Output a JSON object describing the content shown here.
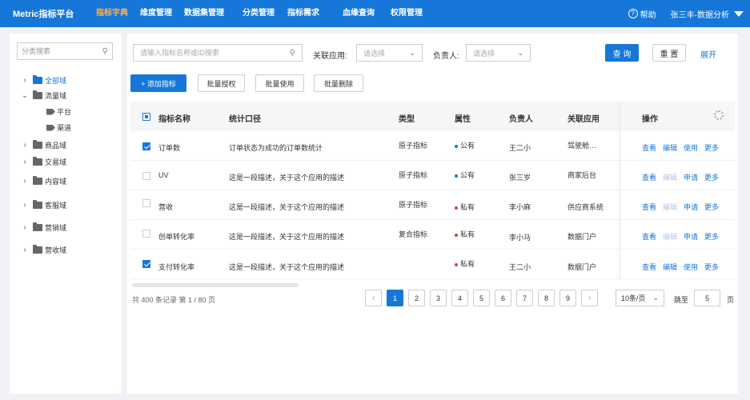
{
  "app": {
    "title": "Metric指标平台"
  },
  "nav": [
    {
      "label": "指标字典",
      "active": true
    },
    {
      "label": "维度管理",
      "active": false
    },
    {
      "label": "数据集管理",
      "active": false
    },
    {
      "label": "分类管理",
      "active": false
    },
    {
      "label": "指标需求",
      "active": false
    },
    {
      "label": "血缘查询",
      "active": false
    },
    {
      "label": "权限管理",
      "active": false
    }
  ],
  "header": {
    "help_label": "帮助",
    "user_label": "张三丰-数据分析"
  },
  "sidebar": {
    "search_placeholder": "分类搜索",
    "tree": [
      {
        "label": "全部域",
        "expanded": false,
        "selected": true
      },
      {
        "label": "流量域",
        "expanded": true,
        "selected": false
      },
      {
        "label": "平台",
        "leaf": true
      },
      {
        "label": "渠道",
        "leaf": true
      },
      {
        "label": "商品域",
        "expanded": false
      },
      {
        "label": "交易域",
        "expanded": false
      },
      {
        "label": "内容域",
        "expanded": false
      },
      {
        "label": "客服域",
        "expanded": false
      },
      {
        "label": "营销域",
        "expanded": false
      },
      {
        "label": "营收域",
        "expanded": false
      }
    ]
  },
  "filters": {
    "keyword_placeholder": "请输入指标名称或ID搜索",
    "app_label": "关联应用:",
    "app_placeholder": "请选择",
    "owner_label": "负责人:",
    "owner_placeholder": "请选择",
    "query_label": "查 询",
    "reset_label": "重 置",
    "expand_label": "展开"
  },
  "toolbar": {
    "add_label": "+ 添加指标",
    "batch_auth_label": "批量授权",
    "batch_use_label": "批量使用",
    "batch_delete_label": "批量删除"
  },
  "table": {
    "columns": [
      "指标名称",
      "统计口径",
      "类型",
      "属性",
      "负责人",
      "关联应用",
      "操作"
    ],
    "rows": [
      {
        "checked": true,
        "name": "订单数",
        "caliber": "订单状态为成功的订单数统计",
        "type": "原子指标",
        "attr": "公有",
        "attr_color": "#1677d9",
        "owner": "王二小",
        "app": "驾驶舱…",
        "actions": [
          "查看",
          "编辑",
          "使用",
          "更多"
        ],
        "edit_disabled": false
      },
      {
        "checked": false,
        "name": "UV",
        "caliber": "这是一段描述，关于这个应用的描述",
        "type": "原子指标",
        "attr": "公有",
        "attr_color": "#1677d9",
        "owner": "张三岁",
        "app": "商家后台",
        "actions": [
          "查看",
          "编辑",
          "申请",
          "更多"
        ],
        "edit_disabled": true
      },
      {
        "checked": false,
        "name": "营收",
        "caliber": "这是一段描述，关于这个应用的描述",
        "type": "原子指标",
        "attr": "私有",
        "attr_color": "#e53935",
        "owner": "李小麻",
        "app": "供应商系统",
        "actions": [
          "查看",
          "编辑",
          "申请",
          "更多"
        ],
        "edit_disabled": true
      },
      {
        "checked": false,
        "name": "创单转化率",
        "caliber": "这是一段描述，关于这个应用的描述",
        "type": "复合指标",
        "attr": "私有",
        "attr_color": "#e53935",
        "owner": "李小马",
        "app": "数据门户",
        "actions": [
          "查看",
          "编辑",
          "申请",
          "更多"
        ],
        "edit_disabled": true
      },
      {
        "checked": true,
        "name": "支付转化率",
        "caliber": "这是一段描述，关于这个应用的描述",
        "type": "",
        "attr": "私有",
        "attr_color": "#e53935",
        "owner": "王二小",
        "app": "数据门户",
        "actions": [
          "查看",
          "编辑",
          "使用",
          "更多"
        ],
        "edit_disabled": false
      }
    ]
  },
  "pagination": {
    "summary": "共 400 条记录 第 1 / 80 页",
    "pages": [
      "1",
      "2",
      "3",
      "4",
      "5",
      "6",
      "7",
      "8",
      "9"
    ],
    "current": "1",
    "page_size_label": "10条/页",
    "jump_label": "跳至",
    "jump_value": "5",
    "page_suffix": "页"
  },
  "colors": {
    "primary": "#1677d9",
    "nav_active": "#ffb547",
    "private_dot": "#e53935"
  }
}
